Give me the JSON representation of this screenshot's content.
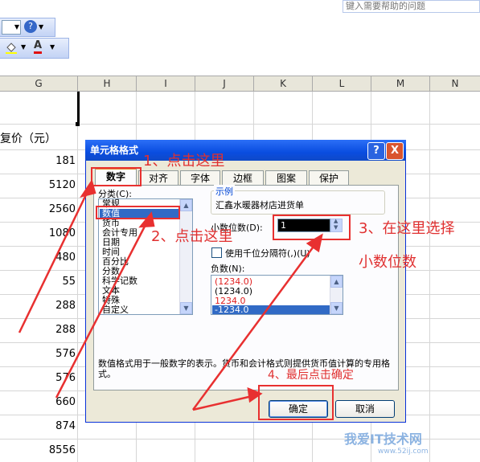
{
  "help": {
    "placeholder": "键入需要帮助的问题"
  },
  "columns": [
    "G",
    "H",
    "I",
    "J",
    "K",
    "L",
    "M",
    "N"
  ],
  "sheet": {
    "header_partial": "复价（元）",
    "values": [
      "181",
      "5120",
      "2560",
      "1080",
      "480",
      "55",
      "288",
      "288",
      "576",
      "576",
      "660",
      "874",
      "8556"
    ]
  },
  "dialog": {
    "title": "单元格格式",
    "help_btn": "?",
    "close_btn": "X",
    "tabs": [
      "数字",
      "对齐",
      "字体",
      "边框",
      "图案",
      "保护"
    ],
    "category_label": "分类(C):",
    "categories": [
      "常规",
      "数值",
      "货币",
      "会计专用",
      "日期",
      "时间",
      "百分比",
      "分数",
      "科学记数",
      "文本",
      "特殊",
      "自定义"
    ],
    "selected_category": "数值",
    "sample_label": "示例",
    "sample_value": "汇鑫水暖器材店进货单",
    "decimals_label": "小数位数(D):",
    "decimals_value": "1",
    "thousands_label": "使用千位分隔符(,)(U)",
    "negative_label": "负数(N):",
    "negatives": [
      "(1234.0)",
      "(1234.0)",
      "1234.0",
      "-1234.0"
    ],
    "description": "数值格式用于一般数字的表示。货币和会计格式则提供货币值计算的专用格式。",
    "ok": "确定",
    "cancel": "取消"
  },
  "annotations": {
    "step1": "1、点击这里",
    "step2": "2、点击这里",
    "step3_line1": "3、在这里选择",
    "step3_line2": "小数位数",
    "step4": "4、最后点击确定"
  },
  "watermark": {
    "text": "我爱IT技术网",
    "url": "www.52ij.com"
  }
}
